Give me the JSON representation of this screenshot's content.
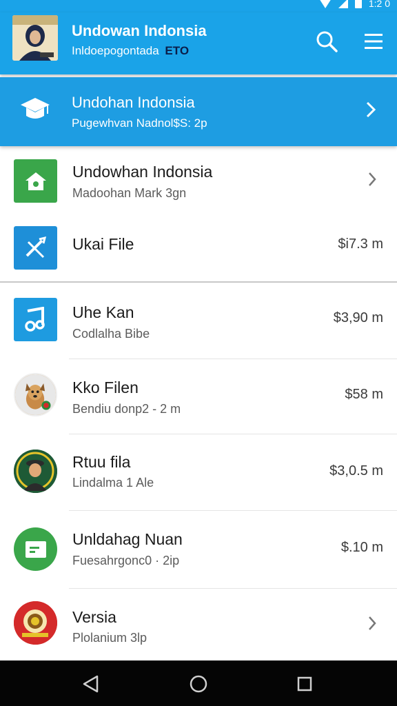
{
  "status_bar": {
    "time": "1:2 0"
  },
  "app_bar": {
    "title": "Undowan Indonsia",
    "subtitle": "Inldoepogontada",
    "subtitle_badge": "ETO"
  },
  "featured": {
    "title": "Undohan Indonsia",
    "subtitle": "Pugewhvan Nadnol$S: 2p"
  },
  "list": [
    {
      "title": "Undowhan Indonsia",
      "subtitle": "Madoohan Mark 3gn",
      "value": "",
      "icon": "home-icon",
      "icon_color": "#3aa64a"
    },
    {
      "title": "Ukai File",
      "subtitle": "",
      "value": "$i7.3 m",
      "icon": "tools-icon",
      "icon_color": "#1e8fd8"
    },
    {
      "title": "Uhe Kan",
      "subtitle": "Codlalha Bibe",
      "value": "$3,90  m",
      "icon": "music-icon",
      "icon_color": "#1e9be0"
    },
    {
      "title": "Kko Filen",
      "subtitle": "Bendiu donp2 - 2 m",
      "value": "$58 m",
      "icon": "dog-photo",
      "icon_color": "#d9a35f"
    },
    {
      "title": "Rtuu fila",
      "subtitle": "Lindalma 1 Ale",
      "value": "$3,0.5 m",
      "icon": "person-photo",
      "icon_color": "#1e5a36"
    },
    {
      "title": "Unldahag Nuan",
      "subtitle": "Fuesahrgonc0 · 2ip",
      "value": "$.10 m",
      "icon": "document-icon",
      "icon_color": "#3aa64a"
    },
    {
      "title": "Versia",
      "subtitle": "Plolanium 3lp",
      "value": "",
      "icon": "emblem-icon",
      "icon_color": "#d42a2a"
    }
  ],
  "colors": {
    "primary": "#1aa3e8",
    "banner": "#1e9de2",
    "nav_bar": "#050505"
  }
}
